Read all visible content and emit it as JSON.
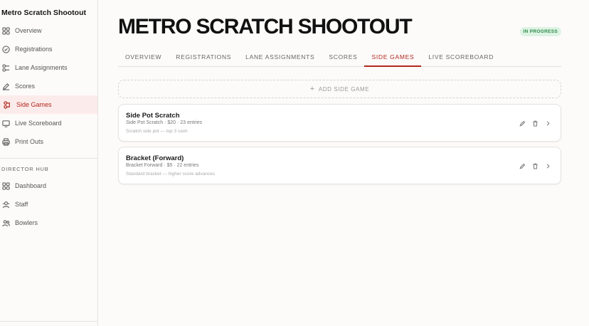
{
  "sidebar": {
    "title": "Metro Scratch Shootout",
    "items": [
      {
        "label": "Overview",
        "icon": "grid-icon"
      },
      {
        "label": "Registrations",
        "icon": "check-circle-icon"
      },
      {
        "label": "Lane Assignments",
        "icon": "lanes-icon"
      },
      {
        "label": "Scores",
        "icon": "edit-icon"
      },
      {
        "label": "Side Games",
        "icon": "side-games-icon"
      },
      {
        "label": "Live Scoreboard",
        "icon": "monitor-icon"
      },
      {
        "label": "Print Outs",
        "icon": "printer-icon"
      }
    ],
    "director_hub": {
      "label": "DIRECTOR HUB",
      "items": [
        {
          "label": "Dashboard",
          "icon": "grid-icon"
        },
        {
          "label": "Staff",
          "icon": "staff-icon"
        },
        {
          "label": "Bowlers",
          "icon": "users-icon"
        }
      ]
    }
  },
  "header": {
    "title": "METRO SCRATCH SHOOTOUT",
    "status": "IN PROGRESS"
  },
  "tabs": [
    "OVERVIEW",
    "REGISTRATIONS",
    "LANE ASSIGNMENTS",
    "SCORES",
    "SIDE GAMES",
    "LIVE SCOREBOARD"
  ],
  "add_button": {
    "label": "ADD SIDE GAME"
  },
  "side_games": [
    {
      "title": "Side Pot Scratch",
      "meta": "Side Pot Scratch · $20 · 23 entries",
      "desc": "Scratch side pot — top 3 cash"
    },
    {
      "title": "Bracket (Forward)",
      "meta": "Bracket Forward · $5 · 22 entries",
      "desc": "Standard bracket — higher score advances"
    }
  ],
  "colors": {
    "accent": "#b3261e",
    "active_bg": "#fbeceb",
    "badge_bg": "#ddf3e3",
    "badge_fg": "#2f8a4a"
  }
}
